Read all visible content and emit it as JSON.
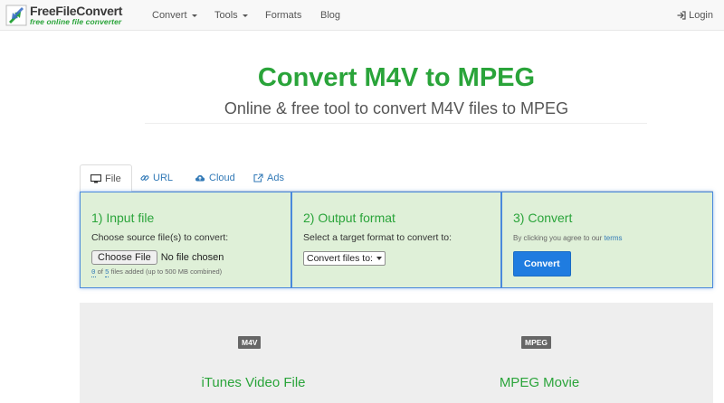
{
  "brand": {
    "name": "FreeFileConvert",
    "tagline": "free online file converter"
  },
  "nav": {
    "items": [
      {
        "label": "Convert",
        "dropdown": true
      },
      {
        "label": "Tools",
        "dropdown": true
      },
      {
        "label": "Formats",
        "dropdown": false
      },
      {
        "label": "Blog",
        "dropdown": false
      }
    ],
    "login_label": "Login"
  },
  "hero": {
    "title": "Convert M4V to MPEG",
    "subtitle": "Online & free tool to convert M4V files to MPEG"
  },
  "tabs": [
    {
      "label": "File",
      "icon": "monitor-icon",
      "active": true
    },
    {
      "label": "URL",
      "icon": "link-icon",
      "active": false
    },
    {
      "label": "Cloud",
      "icon": "cloud-upload-icon",
      "active": false
    },
    {
      "label": "Ads",
      "icon": "external-link-icon",
      "active": false
    }
  ],
  "step1": {
    "heading": "1) Input file",
    "instruction": "Choose source file(s) to convert:",
    "choose_button": "Choose File",
    "no_file": "No file chosen",
    "files_count": "0",
    "files_max": "5",
    "of": "of",
    "files_suffix": "files added (up to 500 MB combined)"
  },
  "step2": {
    "heading": "2) Output format",
    "instruction": "Select a target format to convert to:",
    "select_value": "Convert files to:"
  },
  "step3": {
    "heading": "3) Convert",
    "agree_text": "By clicking you agree to our",
    "terms_link": "terms",
    "convert_button": "Convert"
  },
  "formats": {
    "source": {
      "badge": "M4V",
      "name": "iTunes Video File"
    },
    "target": {
      "badge": "MPEG",
      "name": "MPEG Movie"
    }
  },
  "colors": {
    "brand_green": "#2aa43a",
    "panel_bg": "#dff0d8",
    "panel_border": "#4a89dc",
    "primary_button": "#1f7ce0",
    "link": "#337ab7"
  }
}
